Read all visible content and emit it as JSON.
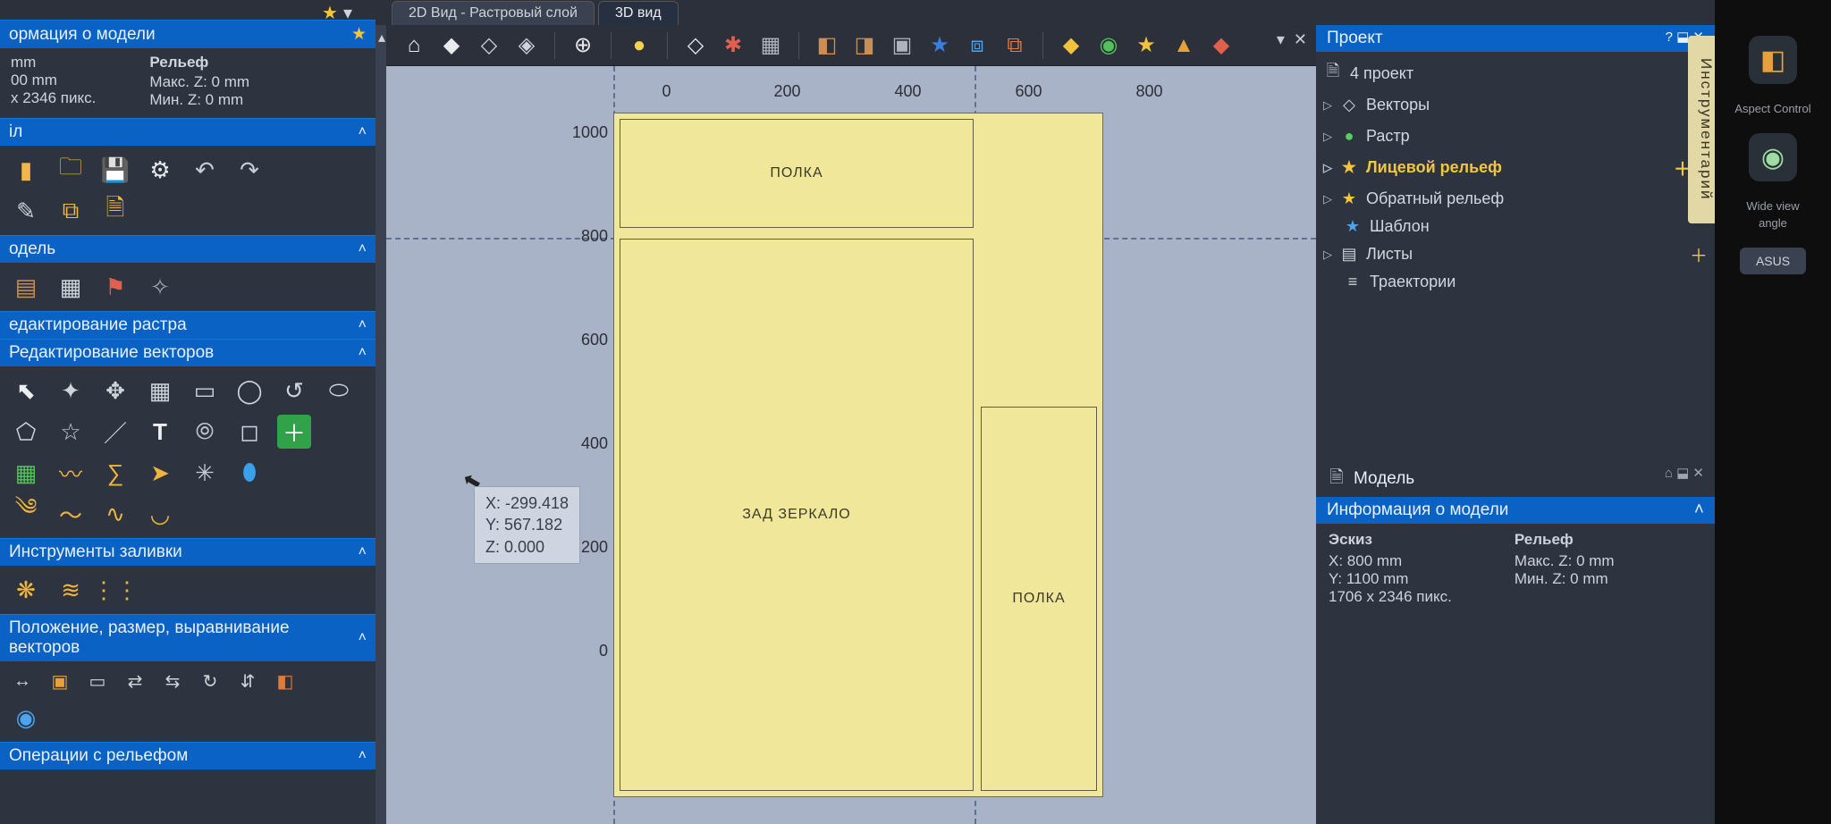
{
  "tabs": {
    "tab1": "2D Вид - Растровый слой",
    "tab2": "3D вид"
  },
  "left": {
    "info_title": "ормация о модели",
    "sketch": {
      "x": "mm",
      "y": "00 mm",
      "px": "x 2346 пикс."
    },
    "relief_title": "Рельеф",
    "relief": {
      "max": "Макс. Z: 0 mm",
      "min": "Мин. Z: 0 mm"
    },
    "section_file": "іл",
    "section_model": "одель",
    "section_raster": "едактирование растра",
    "section_vectors": "Редактирование векторов",
    "section_fill": "Инструменты заливки",
    "section_pos": "Положение, размер, выравнивание векторов",
    "section_relief": "Операции с рельефом"
  },
  "cursor": {
    "x": "X: -299.418",
    "y": "Y: 567.182",
    "z": "Z: 0.000"
  },
  "ruler_top": [
    "0",
    "200",
    "400",
    "600",
    "800"
  ],
  "ruler_left": [
    "1000",
    "800",
    "600",
    "400",
    "200",
    "0"
  ],
  "parts": {
    "polka1": "ПОЛКА",
    "zad": "ЗАД ЗЕРКАЛО",
    "polka2": "ПОЛКА"
  },
  "project": {
    "title": "Проект",
    "root": "4 проект",
    "items": {
      "vectors": "Векторы",
      "raster": "Растр",
      "front_relief": "Лицевой рельеф",
      "back_relief": "Обратный рельеф",
      "template": "Шаблон",
      "sheets": "Листы",
      "toolpaths": "Траектории"
    },
    "vtab": "Инструментарий"
  },
  "model_panel": {
    "tab": "Модель",
    "title": "Информация о модели",
    "sketch_title": "Эскиз",
    "sketch": {
      "x": "X: 800 mm",
      "y": "Y: 1100 mm",
      "px": "1706 x 2346 пикс."
    },
    "relief_title": "Рельеф",
    "relief": {
      "max": "Макс. Z: 0 mm",
      "min": "Мин. Z: 0 mm"
    }
  },
  "bezel": {
    "aspect": "Aspect Control",
    "wide1": "Wide view",
    "wide2": "angle"
  }
}
